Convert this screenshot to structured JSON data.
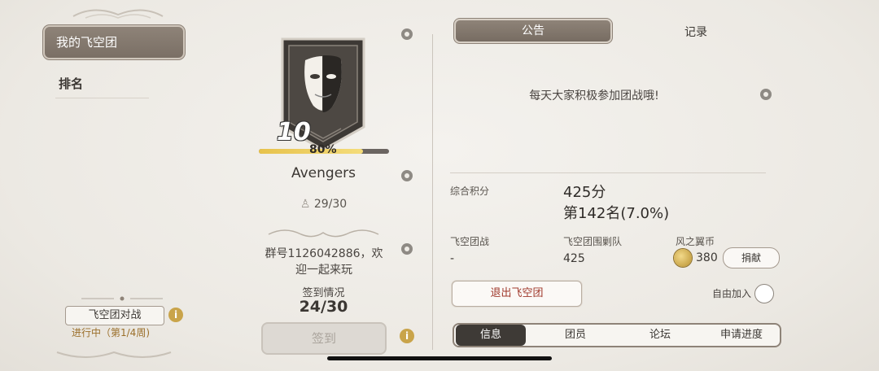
{
  "left": {
    "my_team_label": "我的飞空团",
    "rank_label": "排名",
    "battle_label": "飞空团对战",
    "battle_progress": "进行中（第1/4周)"
  },
  "center": {
    "level": "10",
    "exp_label": "80%",
    "exp_fraction": 0.8,
    "team_name": "Avengers",
    "members": "29/30",
    "description_line1": "群号1126042886，欢",
    "description_line2": "迎一起来玩",
    "checkin_label": "签到情况",
    "checkin_count": "24/30",
    "checkin_button": "签到"
  },
  "right": {
    "tabs": {
      "notice": "公告",
      "record": "记录"
    },
    "notice_text": "每天大家积极参加团战哦!",
    "score_label": "综合积分",
    "score_value": "425分",
    "rank_value": "第142名(7.0%)",
    "battle_label": "飞空团战",
    "battle_value": "-",
    "raid_label": "飞空团围剿队",
    "raid_value": "425",
    "coin_label": "风之翼币",
    "coin_value": "380",
    "donate_button": "捐献",
    "leave_button": "退出飞空团",
    "free_join_label": "自由加入",
    "bottom_tabs": [
      "信息",
      "团员",
      "论坛",
      "申请进度"
    ]
  },
  "colors": {
    "background": "#efece6",
    "accent_brown": "#8e8378",
    "gold": "#c9a44a",
    "leave_red": "#a0392c"
  },
  "icons": [
    "settings-gear-icon",
    "info-icon",
    "member-person-icon",
    "coin-icon",
    "mask-emblem-icon"
  ]
}
